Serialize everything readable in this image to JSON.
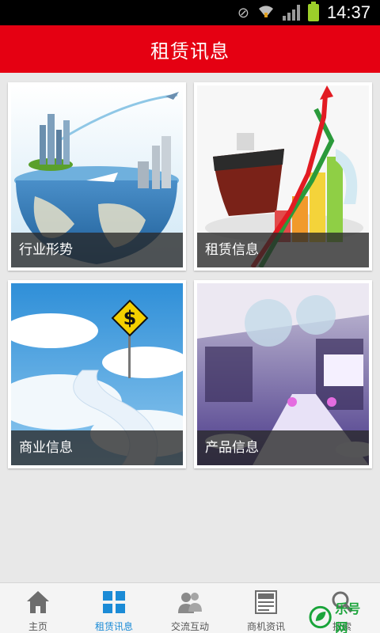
{
  "status_bar": {
    "time": "14:37"
  },
  "header": {
    "title": "租赁讯息"
  },
  "cards": [
    {
      "label": "行业形势"
    },
    {
      "label": "租赁信息"
    },
    {
      "label": "商业信息"
    },
    {
      "label": "产品信息"
    }
  ],
  "bottom_nav": [
    {
      "label": "主页",
      "icon": "home-icon"
    },
    {
      "label": "租赁讯息",
      "icon": "grid-icon",
      "active": true
    },
    {
      "label": "交流互动",
      "icon": "users-icon"
    },
    {
      "label": "商机资讯",
      "icon": "news-icon"
    },
    {
      "label": "搜索",
      "icon": "search-icon"
    }
  ],
  "watermark": {
    "text": "乐号网"
  },
  "colors": {
    "primary": "#e50012",
    "active": "#1b8bd6",
    "background": "#e8e8e8"
  }
}
